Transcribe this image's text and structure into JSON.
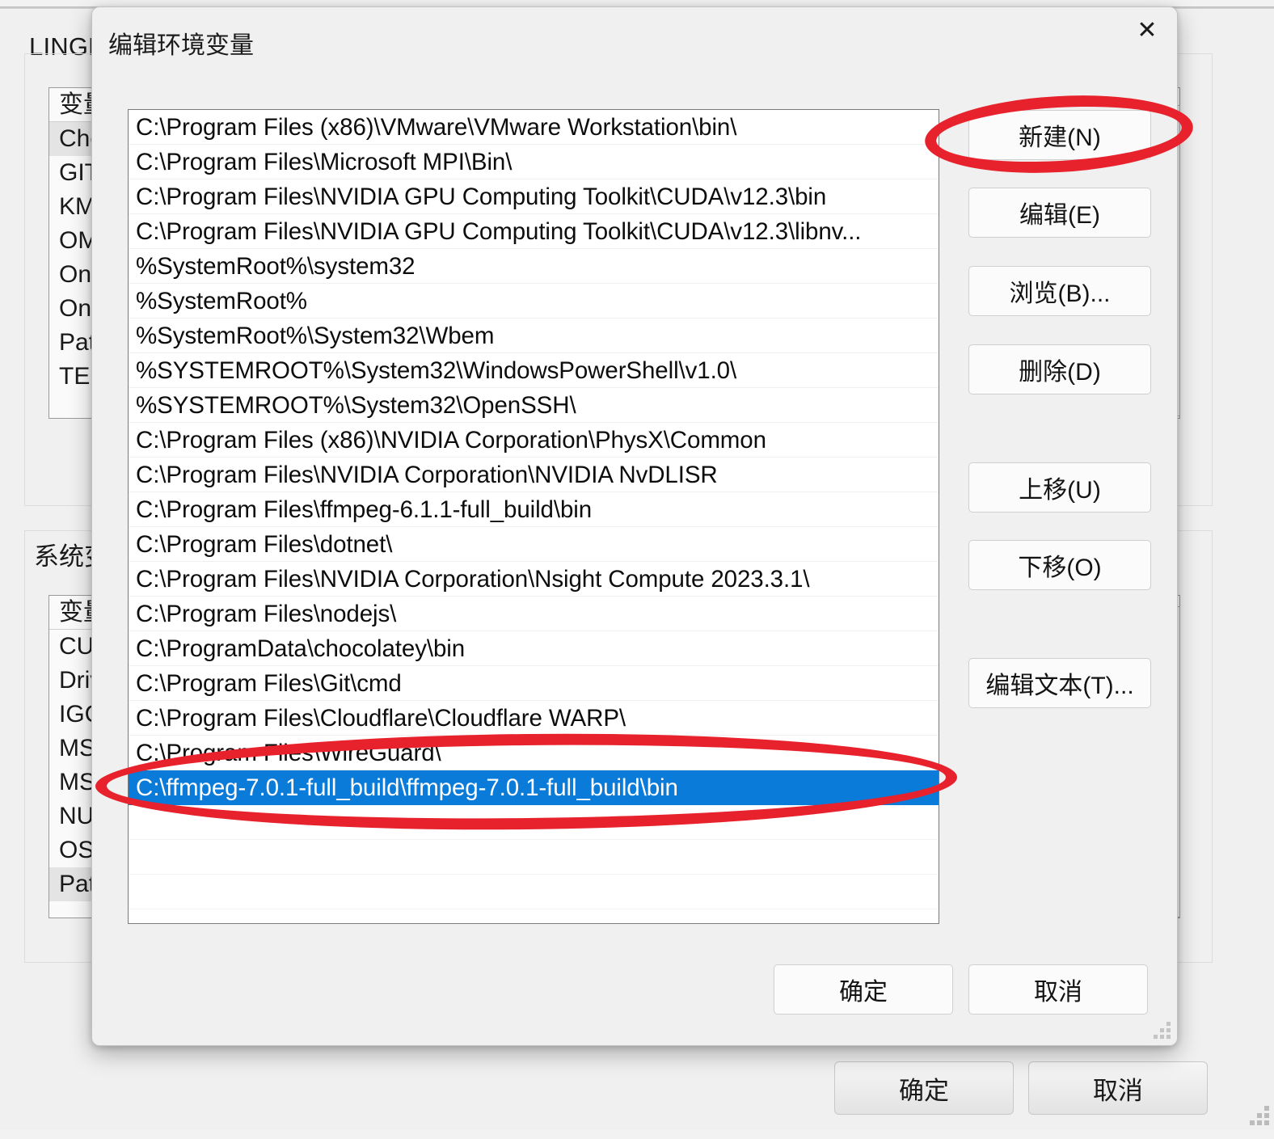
{
  "background_window": {
    "title": "LINGFENG",
    "user_section": {
      "list_header": "变量",
      "rows": [
        "Cho",
        "GIT",
        "KM",
        "OM",
        "One",
        "One",
        "Pat",
        "TEM"
      ],
      "selected_index": 0
    },
    "system_section": {
      "label": "系统变量",
      "list_header": "变量",
      "rows": [
        "CUD",
        "Driv",
        "IGC",
        "MS",
        "MS",
        "NU",
        "OS",
        "Pat"
      ],
      "selected_index": 7
    },
    "buttons": {
      "ok": "确定",
      "cancel": "取消"
    },
    "icons": {
      "resize_grip": "resize-grip-icon"
    }
  },
  "dialog": {
    "title": "编辑环境变量",
    "close_glyph": "✕",
    "close_icon_name": "close-icon",
    "selection_color": "#0a7bd8",
    "path_entries": [
      "C:\\Program Files (x86)\\VMware\\VMware Workstation\\bin\\",
      "C:\\Program Files\\Microsoft MPI\\Bin\\",
      "C:\\Program Files\\NVIDIA GPU Computing Toolkit\\CUDA\\v12.3\\bin",
      "C:\\Program Files\\NVIDIA GPU Computing Toolkit\\CUDA\\v12.3\\libnv...",
      "%SystemRoot%\\system32",
      "%SystemRoot%",
      "%SystemRoot%\\System32\\Wbem",
      "%SYSTEMROOT%\\System32\\WindowsPowerShell\\v1.0\\",
      "%SYSTEMROOT%\\System32\\OpenSSH\\",
      "C:\\Program Files (x86)\\NVIDIA Corporation\\PhysX\\Common",
      "C:\\Program Files\\NVIDIA Corporation\\NVIDIA NvDLISR",
      "C:\\Program Files\\ffmpeg-6.1.1-full_build\\bin",
      "C:\\Program Files\\dotnet\\",
      "C:\\Program Files\\NVIDIA Corporation\\Nsight Compute 2023.3.1\\",
      "C:\\Program Files\\nodejs\\",
      "C:\\ProgramData\\chocolatey\\bin",
      "C:\\Program Files\\Git\\cmd",
      "C:\\Program Files\\Cloudflare\\Cloudflare WARP\\",
      "C:\\Program Files\\WireGuard\\",
      "C:\\ffmpeg-7.0.1-full_build\\ffmpeg-7.0.1-full_build\\bin"
    ],
    "selected_index": 19,
    "empty_rows": 3,
    "side_buttons": {
      "new": "新建(N)",
      "edit": "编辑(E)",
      "browse": "浏览(B)...",
      "delete": "删除(D)",
      "move_up": "上移(U)",
      "move_down": "下移(O)",
      "edit_text": "编辑文本(T)..."
    },
    "footer_buttons": {
      "ok": "确定",
      "cancel": "取消"
    },
    "icons": {
      "resize_grip": "resize-grip-icon"
    }
  },
  "annotations": {
    "color": "#e8222c",
    "marks": [
      {
        "target": "新建(N)",
        "shape": "ellipse"
      },
      {
        "target": "C:\\ffmpeg-7.0.1-full_build\\ffmpeg-7.0.1-full_build\\bin",
        "shape": "ellipse"
      }
    ]
  }
}
